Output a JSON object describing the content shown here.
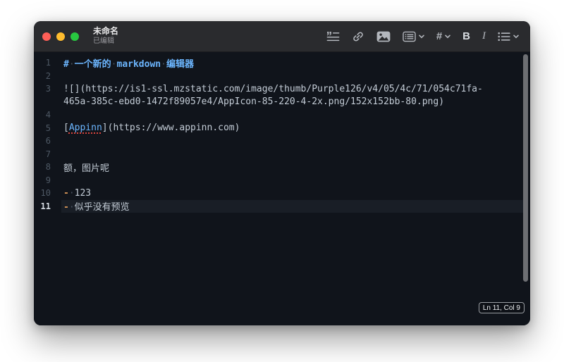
{
  "window": {
    "title": "未命名",
    "subtitle": "已编辑",
    "status": "Ln 11, Col 9"
  },
  "toolbar": {
    "heading_label": "#",
    "bold_label": "B",
    "italic_label": "I",
    "icons": [
      "blockquote-icon",
      "link-icon",
      "image-icon",
      "table-of-contents-icon",
      "heading-icon",
      "bold-icon",
      "italic-icon",
      "list-icon"
    ]
  },
  "editor": {
    "rows": [
      {
        "num": "1",
        "segments": [
          {
            "t": "#",
            "s": "head"
          },
          {
            "t": "·",
            "s": "dot"
          },
          {
            "t": "一个新的",
            "s": "head"
          },
          {
            "t": "·",
            "s": "dot"
          },
          {
            "t": "markdown",
            "s": "head"
          },
          {
            "t": "·",
            "s": "dot"
          },
          {
            "t": "编辑器",
            "s": "head"
          }
        ]
      },
      {
        "num": "2",
        "segments": []
      },
      {
        "num": "3",
        "segments": [
          {
            "t": "![](https://is1-ssl.mzstatic.com/image/thumb/Purple126/v4/05/4c/71/054c71fa-",
            "s": "text"
          }
        ]
      },
      {
        "num": "",
        "segments": [
          {
            "t": "465a-385c-ebd0-1472f89057e4/AppIcon-85-220-4-2x.png/152x152bb-80.png)",
            "s": "text"
          }
        ]
      },
      {
        "num": "4",
        "segments": []
      },
      {
        "num": "5",
        "segments": [
          {
            "t": "[",
            "s": "text"
          },
          {
            "t": "Appinn",
            "s": "link"
          },
          {
            "t": "](https://www.appinn.com)",
            "s": "text"
          }
        ]
      },
      {
        "num": "6",
        "segments": []
      },
      {
        "num": "7",
        "segments": []
      },
      {
        "num": "8",
        "segments": [
          {
            "t": "额，图片呢",
            "s": "text"
          }
        ]
      },
      {
        "num": "9",
        "segments": []
      },
      {
        "num": "10",
        "segments": [
          {
            "t": "-",
            "s": "marker"
          },
          {
            "t": "·",
            "s": "dot"
          },
          {
            "t": "123",
            "s": "text"
          }
        ]
      },
      {
        "num": "11",
        "active": true,
        "segments": [
          {
            "t": "-",
            "s": "marker"
          },
          {
            "t": "·",
            "s": "dot"
          },
          {
            "t": "似乎没有预览",
            "s": "text"
          }
        ]
      }
    ]
  },
  "colors": {
    "accent": "#6cb6ff",
    "marker": "#d29356",
    "titlebarBg": "#2a2b2e",
    "editorBg": "#10141b",
    "text": "#c3ccd6",
    "gutter": "#4e5965",
    "gutterActive": "#d4dae1",
    "dot": "#46505d",
    "lineHighlight": "#191e26",
    "icon": "#b3b7bd",
    "trafficRed": "#ff5f57",
    "trafficYellow": "#febc2e",
    "trafficGreen": "#28c840",
    "underline": "#d9453e",
    "scrollbar": "#6d6f73"
  }
}
